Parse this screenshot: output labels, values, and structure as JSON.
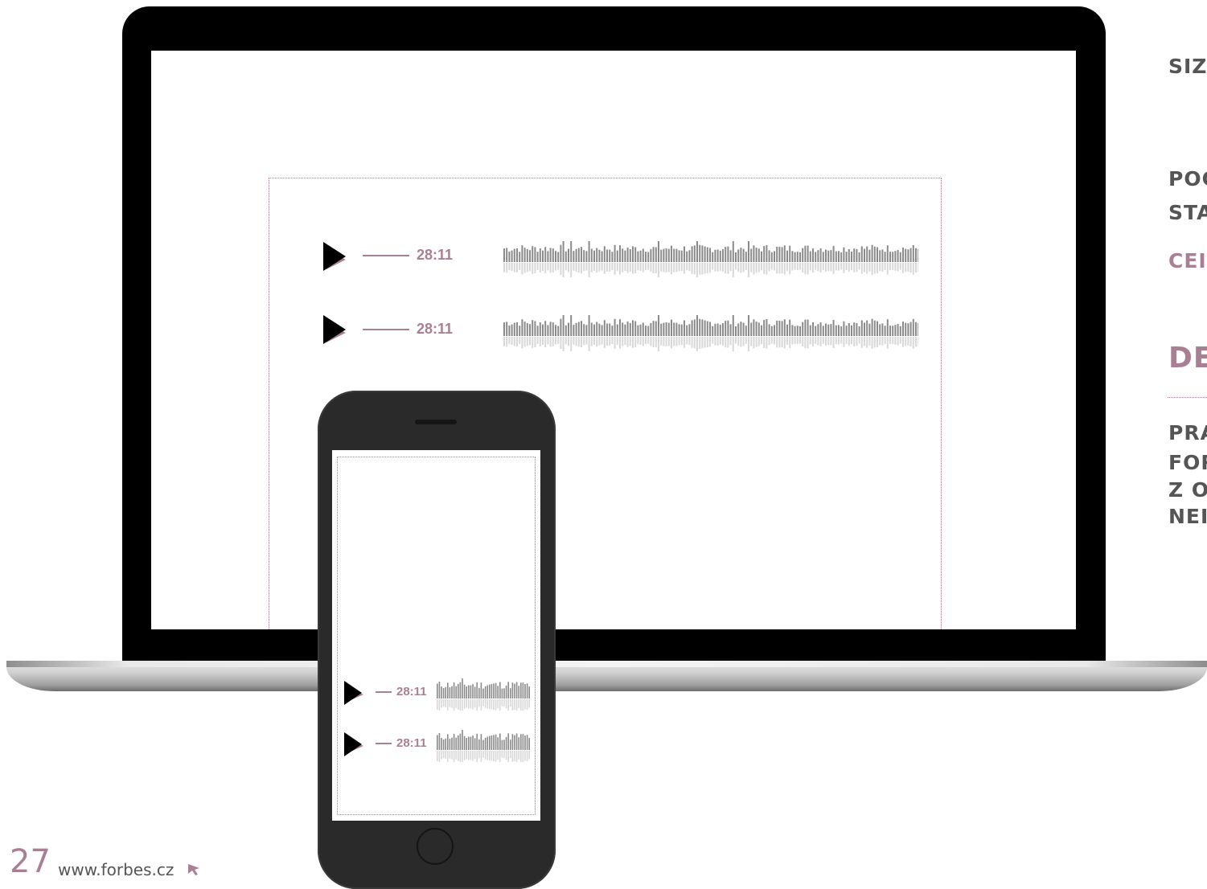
{
  "players": {
    "desktop": [
      {
        "time": "28:11"
      },
      {
        "time": "28:11"
      }
    ],
    "mobile": [
      {
        "time": "28:11"
      },
      {
        "time": "28:11"
      }
    ]
  },
  "side": {
    "line1": "SIZ",
    "line2": "POC",
    "line3": "STA",
    "line4": "CEI",
    "heading": "DE",
    "para1": "PRA",
    "para2": "FOR",
    "para3": "Z O",
    "para4": "NEI"
  },
  "footer": {
    "page_number": "27",
    "url": "www.forbes.cz"
  },
  "colors": {
    "accent": "#a98093",
    "text": "#555555"
  }
}
